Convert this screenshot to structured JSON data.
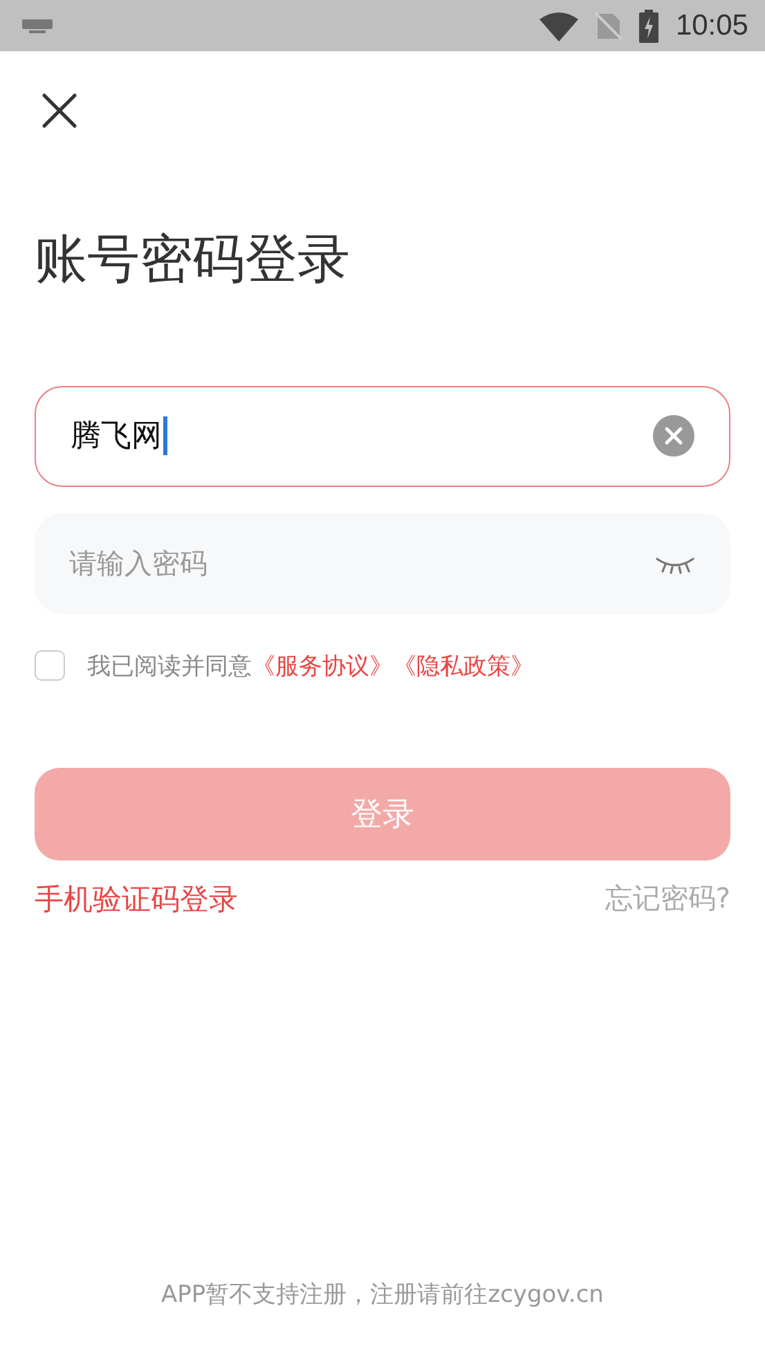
{
  "status_bar": {
    "time": "10:05"
  },
  "title": "账号密码登录",
  "username": {
    "value": "腾飞网",
    "focused": true
  },
  "password": {
    "placeholder": "请输入密码"
  },
  "agreement": {
    "checked": false,
    "text": "我已阅读并同意",
    "links": [
      "《服务协议》",
      "《隐私政策》"
    ]
  },
  "login_button": {
    "label": "登录",
    "disabled": true
  },
  "sms_login": "手机验证码登录",
  "forgot_password": "忘记密码?",
  "footer": "APP暂不支持注册，注册请前往zcygov.cn"
}
